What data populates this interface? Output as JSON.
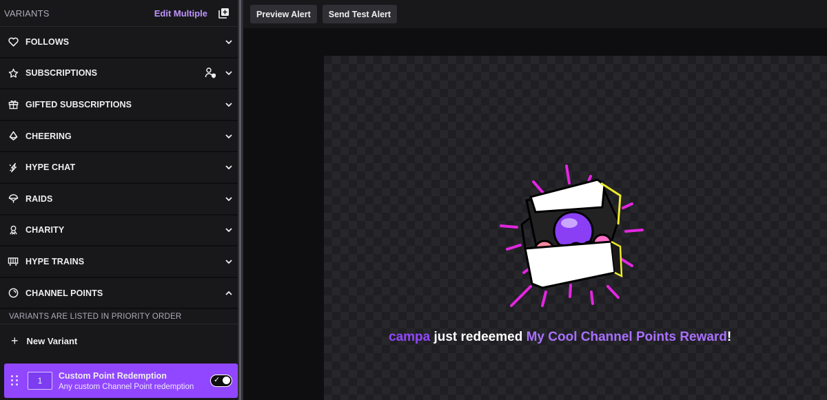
{
  "sidebar": {
    "title": "VARIANTS",
    "edit_multiple": "Edit Multiple",
    "categories": [
      {
        "label": "FOLLOWS",
        "icon": "heart-icon"
      },
      {
        "label": "SUBSCRIPTIONS",
        "icon": "star-icon"
      },
      {
        "label": "GIFTED SUBSCRIPTIONS",
        "icon": "gift-icon"
      },
      {
        "label": "CHEERING",
        "icon": "bits-icon"
      },
      {
        "label": "HYPE CHAT",
        "icon": "hype-chat-icon"
      },
      {
        "label": "RAIDS",
        "icon": "raid-icon"
      },
      {
        "label": "CHARITY",
        "icon": "charity-icon"
      },
      {
        "label": "HYPE TRAINS",
        "icon": "train-icon"
      },
      {
        "label": "CHANNEL POINTS",
        "icon": "channel-points-icon"
      }
    ],
    "priority_note": "VARIANTS ARE LISTED IN PRIORITY ORDER",
    "new_variant": "New Variant",
    "variant": {
      "priority": "1",
      "title": "Custom Point Redemption",
      "subtitle": "Any custom Channel Point redemption",
      "enabled": true
    }
  },
  "toolbar": {
    "preview_alert": "Preview Alert",
    "send_test_alert": "Send Test Alert"
  },
  "preview": {
    "user": "campa",
    "action": "just redeemed",
    "reward": "My Cool Channel Points Reward",
    "suffix": "!"
  },
  "colors": {
    "accent": "#9147ff",
    "accent_light": "#bf94ff",
    "sidebar_bg": "#18181b",
    "page_bg": "#0e0e10"
  }
}
